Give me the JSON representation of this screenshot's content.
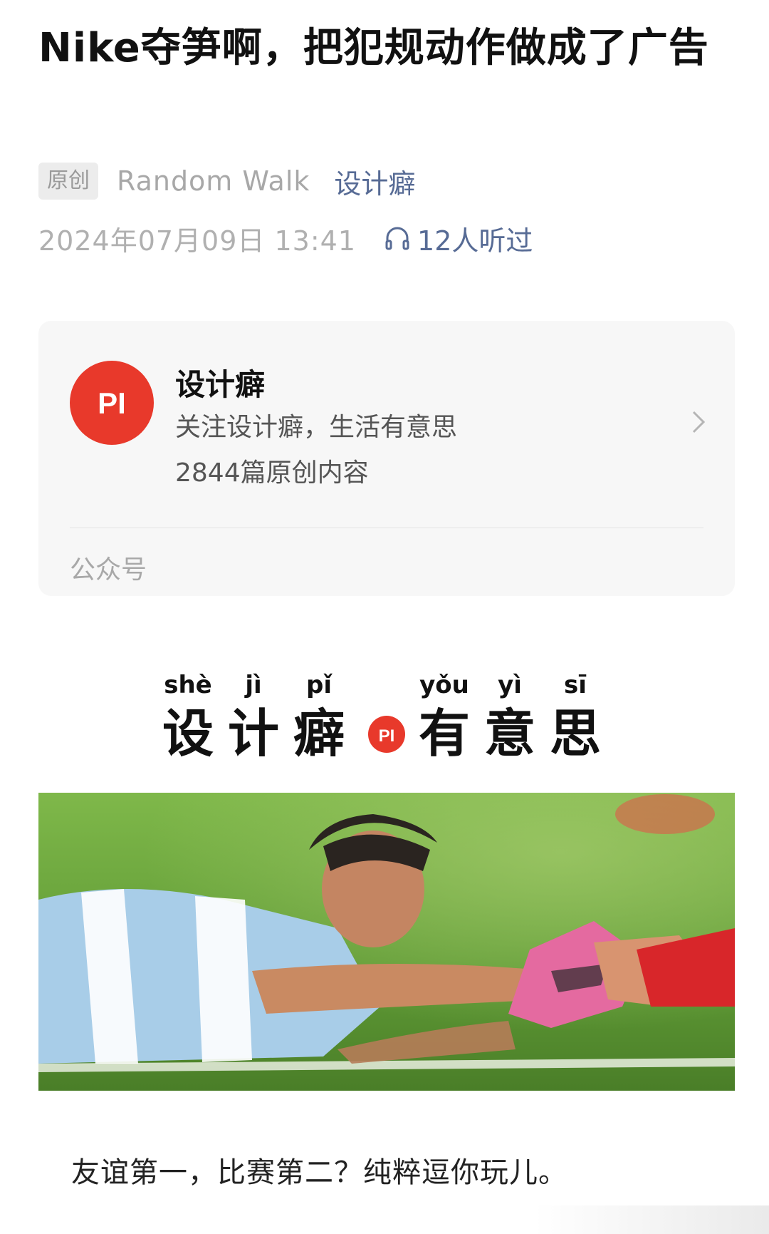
{
  "article": {
    "title": "Nike夺笋啊，把犯规动作做成了广告",
    "original_badge": "原创",
    "author": "Random Walk",
    "account_name": "设计癖",
    "publish_time": "2024年07月09日 13:41",
    "listen_count": "12人听过"
  },
  "profile_card": {
    "avatar_text": "PI",
    "name": "设计癖",
    "description": "关注设计癖，生活有意思",
    "original_count": "2844篇原创内容",
    "footer_label": "公众号"
  },
  "banner": {
    "pinyin": [
      "shè",
      "jì",
      "pǐ",
      "yǒu",
      "yì",
      "sī"
    ],
    "characters": [
      "设",
      "计",
      "癖",
      "有",
      "意",
      "思"
    ],
    "logo_text": "PI"
  },
  "body": {
    "paragraph": "友谊第一，比赛第二？纯粹逗你玩儿。"
  },
  "colors": {
    "brand_red": "#e8392b",
    "link_blue": "#576b95"
  }
}
